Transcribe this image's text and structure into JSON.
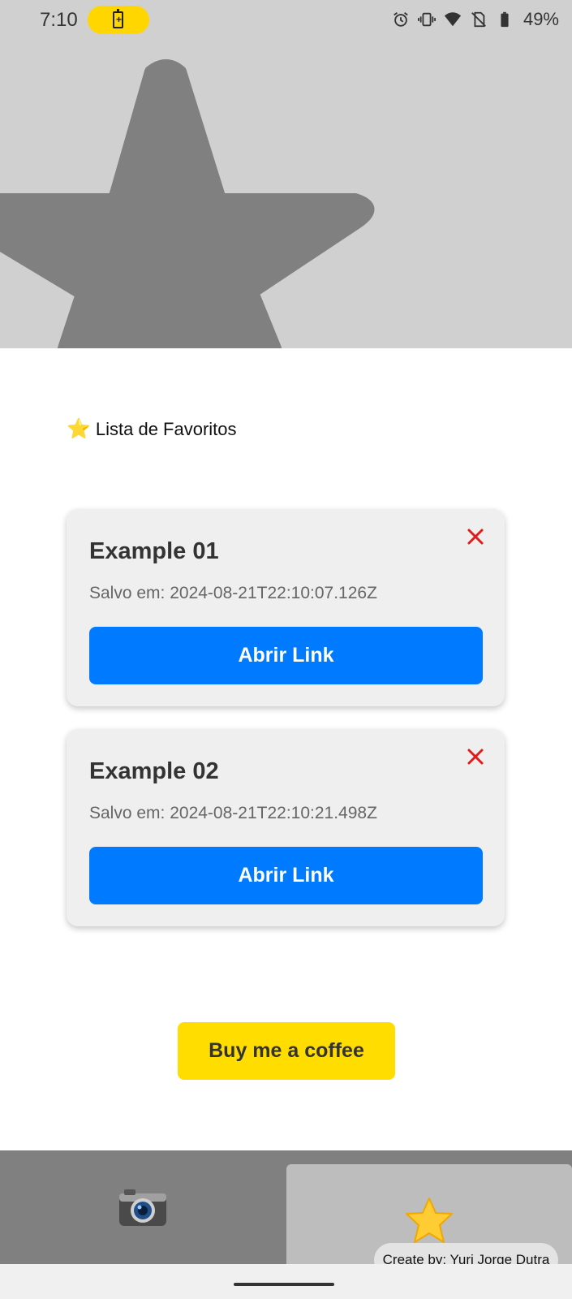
{
  "status_bar": {
    "time": "7:10",
    "battery_percent": "49%",
    "icons": [
      "battery-charging-icon",
      "alarm-icon",
      "vibrate-icon",
      "wifi-icon",
      "no-sim-icon",
      "battery-icon"
    ]
  },
  "hero": {
    "icon": "star-icon"
  },
  "favorites": {
    "heading_emoji": "⭐",
    "heading": "Lista de Favoritos",
    "items": [
      {
        "title": "Example 01",
        "saved": "Salvo em: 2024-08-21T22:10:07.126Z",
        "button": "Abrir Link"
      },
      {
        "title": "Example 02",
        "saved": "Salvo em: 2024-08-21T22:10:21.498Z",
        "button": "Abrir Link"
      }
    ]
  },
  "coffee": {
    "label": "Buy me a coffee"
  },
  "tabs": [
    {
      "icon": "camera-icon",
      "emoji": "📷"
    },
    {
      "icon": "star-icon",
      "emoji": "⭐",
      "active": true
    }
  ],
  "credit": "Create by: Yuri Jorge Dutra",
  "colors": {
    "accent_blue": "#007bff",
    "coffee_yellow": "#ffdd00",
    "delete_red": "#e11a1a",
    "hero_bg": "#d0d0d0",
    "hero_star": "#808080"
  }
}
